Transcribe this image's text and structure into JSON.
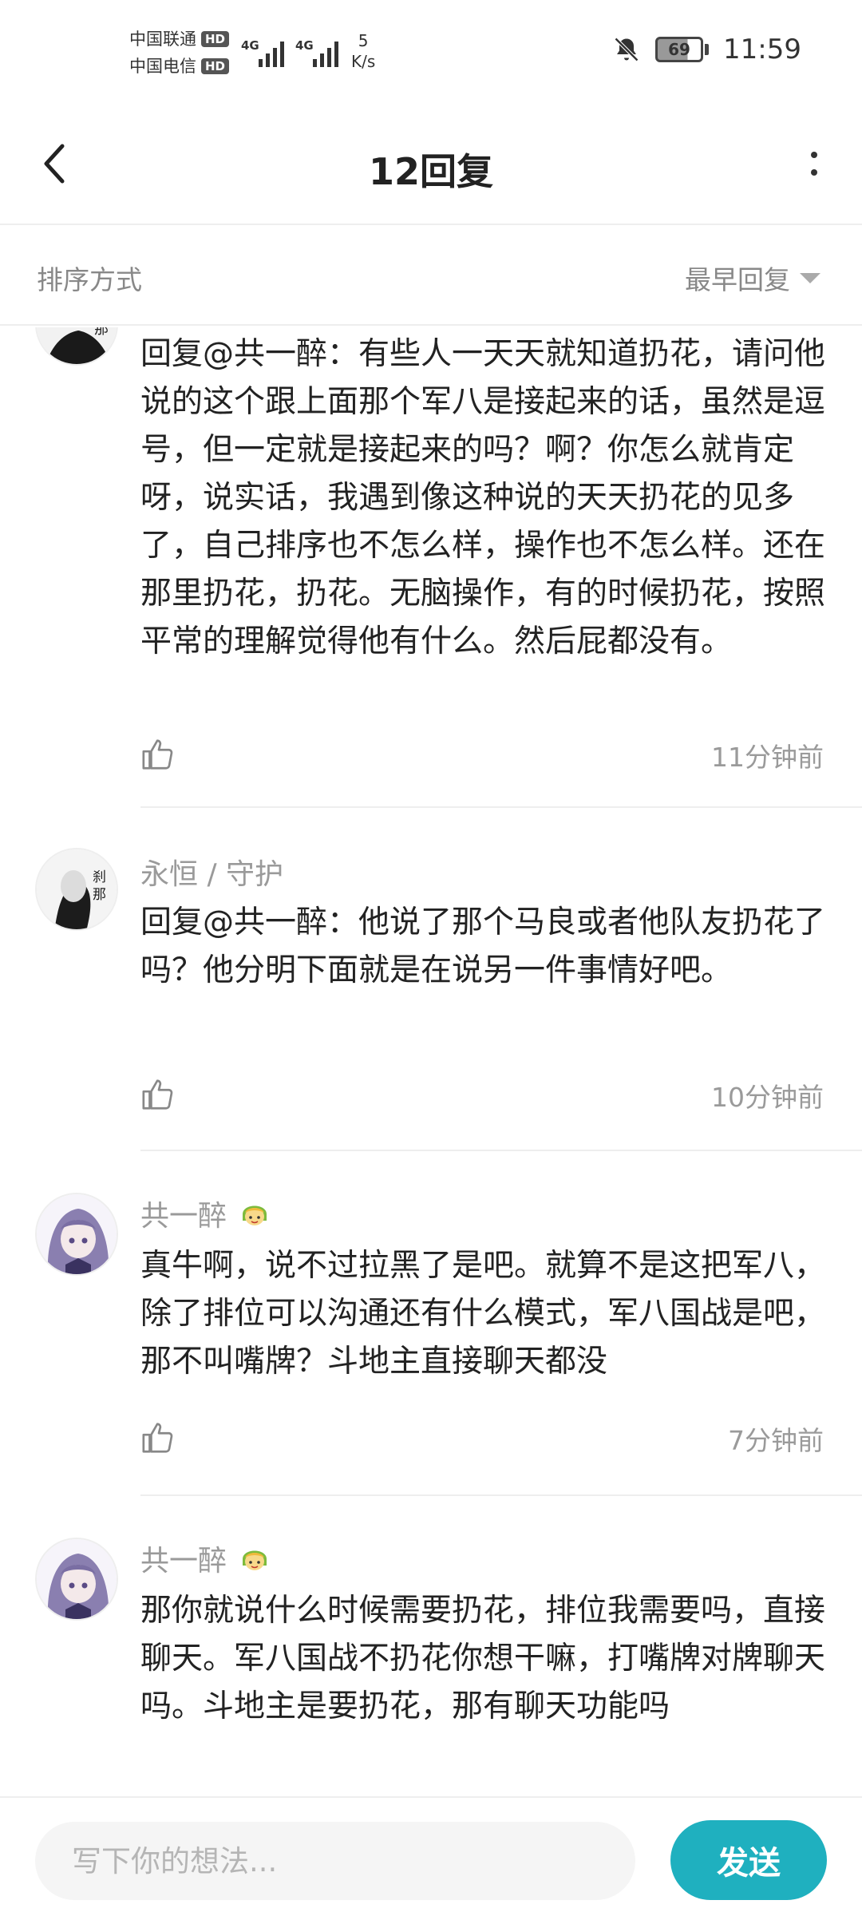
{
  "status_bar": {
    "carrier_1": "中国联通",
    "carrier_2": "中国电信",
    "hd_label": "HD",
    "network_type_1": "4G",
    "network_type_2": "4G",
    "net_speed_value": "5",
    "net_speed_unit": "K/s",
    "battery_level": "69",
    "battery_fraction": 0.69,
    "time": "11:59",
    "icons": [
      "hd-badge-icon",
      "signal-strength-icon",
      "mute-bell-icon",
      "battery-icon"
    ]
  },
  "header": {
    "title": "12回复",
    "back_icon": "chevron-left-icon",
    "more_icon": "more-vertical-icon"
  },
  "sort": {
    "label": "排序方式",
    "selected": "最早回复"
  },
  "comments": [
    {
      "username": "",
      "text": "回复@共一醉：有些人一天天就知道扔花，请问他说的这个跟上面那个军八是接起来的话，虽然是逗号，但一定就是接起来的吗？啊？你怎么就肯定呀，说实话，我遇到像这种说的天天扔花的见多了，自己排序也不怎么样，操作也不怎么样。还在那里扔花，扔花。无脑操作，有的时候扔花，按照平常的理解觉得他有什么。然后屁都没有。",
      "time": "11分钟前",
      "avatar": "ink-portrait-avatar"
    },
    {
      "username": "永恒 / 守护",
      "text": "回复@共一醉：他说了那个马良或者他队友扔花了吗？他分明下面就是在说另一件事情好吧。",
      "time": "10分钟前",
      "avatar": "ink-portrait-avatar"
    },
    {
      "username": "共一醉",
      "text": "真牛啊，说不过拉黑了是吧。就算不是这把军八，除了排位可以沟通还有什么模式，军八国战是吧，那不叫嘴牌？斗地主直接聊天都没",
      "time": "7分钟前",
      "avatar": "anime-girl-avatar",
      "badge": "green-hood-emoji-icon"
    },
    {
      "username": "共一醉",
      "text": "那你就说什么时候需要扔花，排位我需要吗，直接聊天。军八国战不扔花你想干嘛，打嘴牌对牌聊天吗。斗地主是要扔花，那有聊天功能吗",
      "time": "",
      "avatar": "anime-girl-avatar",
      "badge": "green-hood-emoji-icon"
    }
  ],
  "composer": {
    "placeholder": "写下你的想法...",
    "value": "",
    "send_label": "发送",
    "accent_color": "#1fb0bf"
  }
}
